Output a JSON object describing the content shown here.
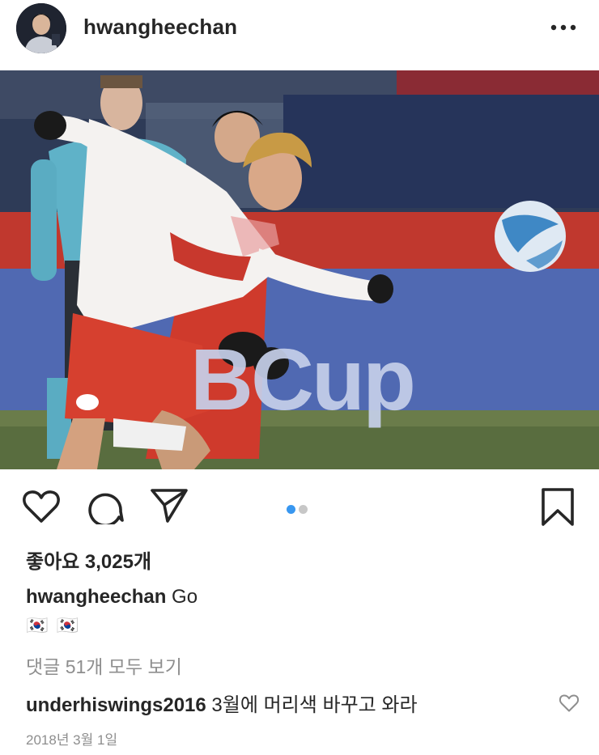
{
  "post": {
    "username": "hwangheechan",
    "photo_banner_text": "BCup",
    "likes_text": "좋아요 3,025개",
    "caption_username": "hwangheechan",
    "caption_text": "Go",
    "caption_flags": "🇰🇷 🇰🇷",
    "view_comments": "댓글 51개 모두 보기",
    "comment": {
      "username": "underhiswings2016",
      "text": "3월에 머리색 바꾸고 와라"
    },
    "date": "2018년 3월 1일"
  },
  "carousel": {
    "active_index": 1,
    "total": 2
  },
  "icons": {
    "more": "more-options-icon",
    "like": "heart-icon",
    "comment": "comment-bubble-icon",
    "share": "paper-plane-icon",
    "save": "bookmark-icon",
    "comment_like": "small-heart-icon"
  },
  "colors": {
    "text": "#262626",
    "secondary": "#8e8e8e",
    "dot_active": "#3897f0",
    "dot_inactive": "#c7c7c7"
  }
}
